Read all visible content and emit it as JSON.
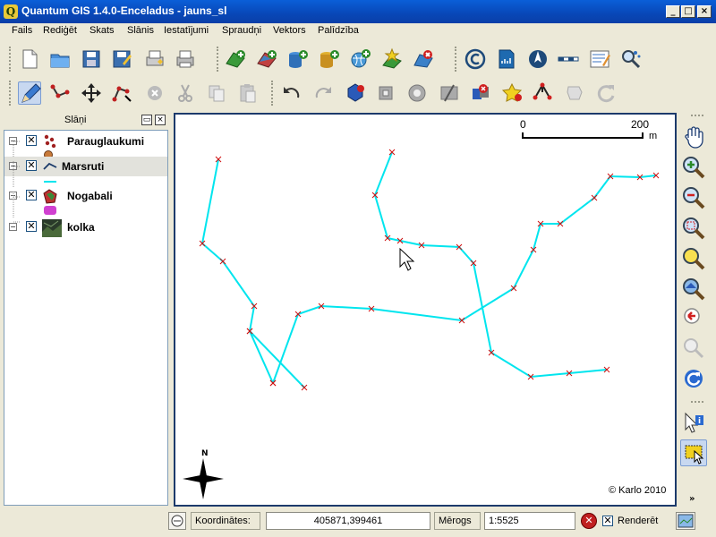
{
  "window": {
    "title": "Quantum GIS 1.4.0-Enceladus - jauns_sl",
    "app_icon_letter": "Q"
  },
  "menu": [
    "Fails",
    "Rediģēt",
    "Skats",
    "Slānis",
    "Iestatījumi",
    "Spraudņi",
    "Vektors",
    "Palīdzība"
  ],
  "legend": {
    "title": "Slāņi",
    "layers": [
      {
        "name": "Parauglaukumi",
        "checked": true,
        "icon": "point-layer-icon"
      },
      {
        "name": "Marsruti",
        "checked": true,
        "icon": "line-layer-icon"
      },
      {
        "name": "Nogabali",
        "checked": true,
        "icon": "polygon-layer-icon"
      },
      {
        "name": "kolka",
        "checked": true,
        "icon": "raster-layer-icon"
      }
    ]
  },
  "map": {
    "scalebar_start": "0",
    "scalebar_end": "200",
    "scalebar_unit": "m",
    "north_arrow_label": "N",
    "copyright": "© Karlo 2010",
    "line_color": "#00e5ee",
    "vertex_color": "#d01010"
  },
  "status": {
    "coords_label": "Koordinātes:",
    "coords_value": "405871,399461",
    "scale_label": "Mērogs",
    "scale_value": "1:5525",
    "render_label": "Renderēt",
    "render_checked": true
  }
}
